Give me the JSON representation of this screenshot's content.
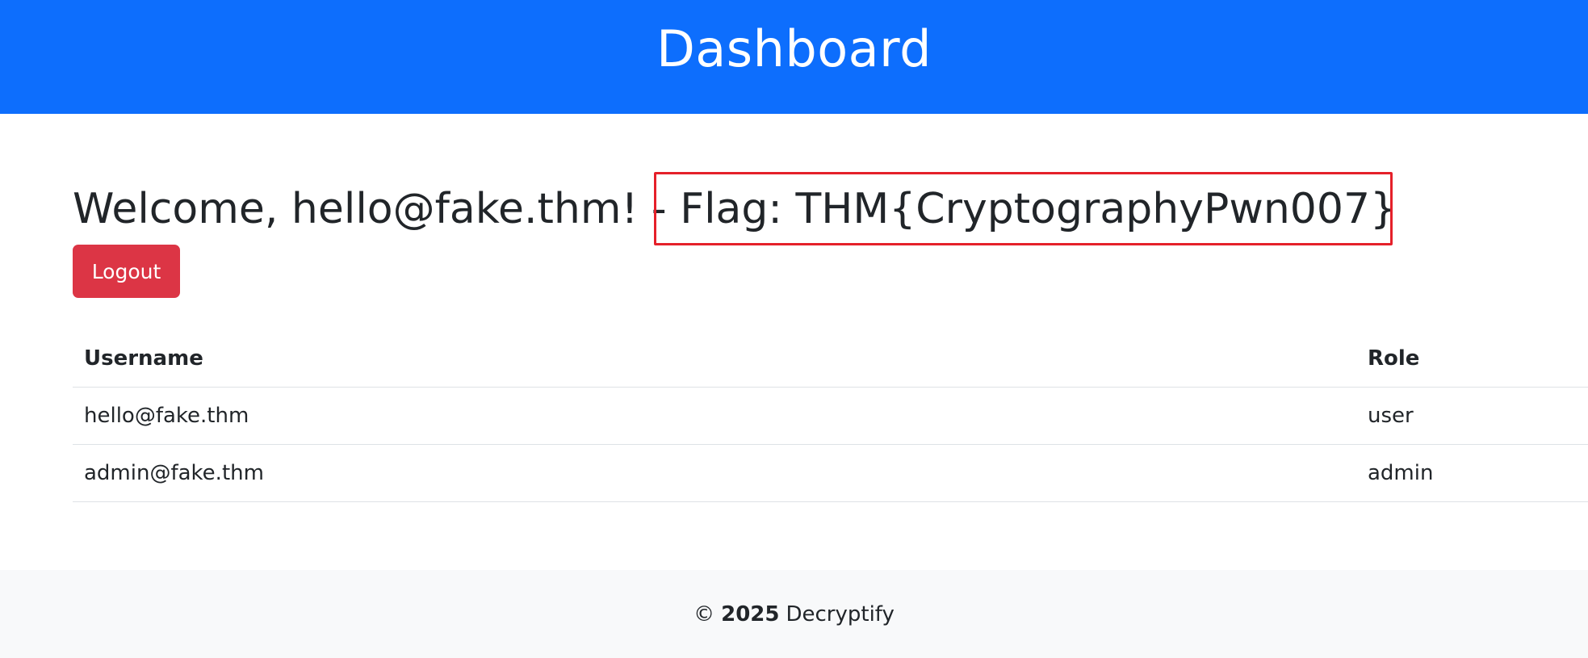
{
  "header": {
    "title": "Dashboard"
  },
  "main": {
    "welcome_text": "Welcome, hello@fake.thm! - ",
    "flag_text": "Flag: THM{CryptographyPwn007}",
    "logout_label": "Logout"
  },
  "table": {
    "headers": [
      "Username",
      "Role"
    ],
    "rows": [
      [
        "hello@fake.thm",
        "user"
      ],
      [
        "admin@fake.thm",
        "admin"
      ]
    ]
  },
  "footer": {
    "copyright": "©",
    "year": "2025",
    "brand": "Decryptify"
  },
  "colors": {
    "header_bg": "#0d6efd",
    "logout_bg": "#dc3545",
    "highlight_border": "#e5202a",
    "footer_bg": "#f8f9fa"
  }
}
